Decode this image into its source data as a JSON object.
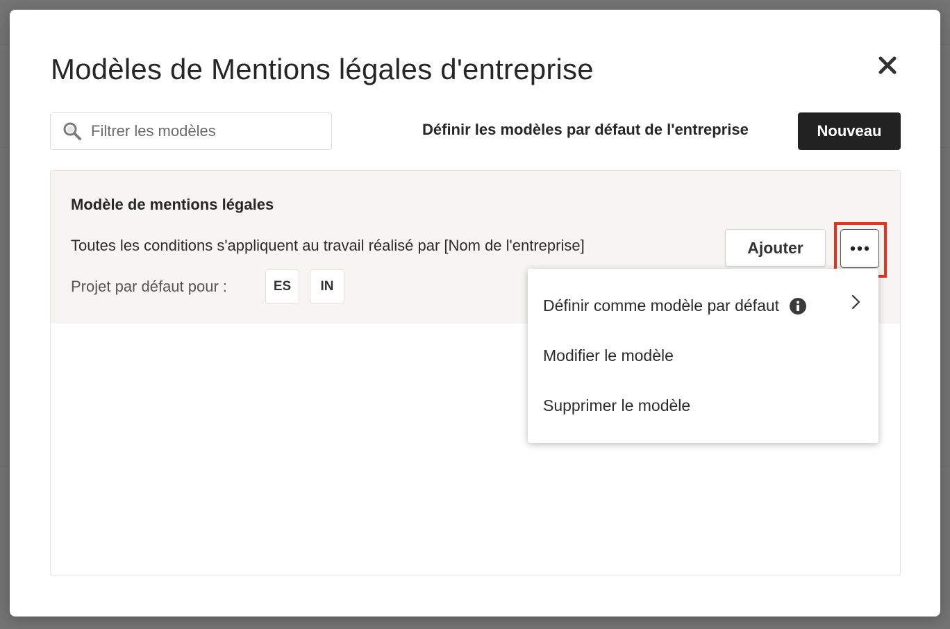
{
  "modal": {
    "title": "Modèles de Mentions légales d'entreprise",
    "close_icon": "close-icon"
  },
  "toolbar": {
    "search_placeholder": "Filtrer les modèles",
    "search_icon": "search-icon",
    "defaults_link": "Définir les modèles par défaut de l'entreprise",
    "new_button": "Nouveau"
  },
  "template": {
    "name": "Modèle de mentions légales",
    "description": "Toutes les conditions s'appliquent au travail réalisé par [Nom de l'entreprise]",
    "default_for_label": "Projet par défaut pour :",
    "default_chips": [
      "ES",
      "IN"
    ],
    "add_button": "Ajouter",
    "more_icon": "more-horizontal-icon"
  },
  "menu": {
    "items": [
      {
        "label": "Définir comme modèle par défaut",
        "icon": "info-icon",
        "submenu_icon": "chevron-right-icon"
      },
      {
        "label": "Modifier le modèle"
      },
      {
        "label": "Supprimer le modèle"
      }
    ]
  },
  "colors": {
    "overlay": "#747474",
    "primary_button": "#222222",
    "card_background": "#f6f5f2",
    "highlight": "#e8321f"
  }
}
